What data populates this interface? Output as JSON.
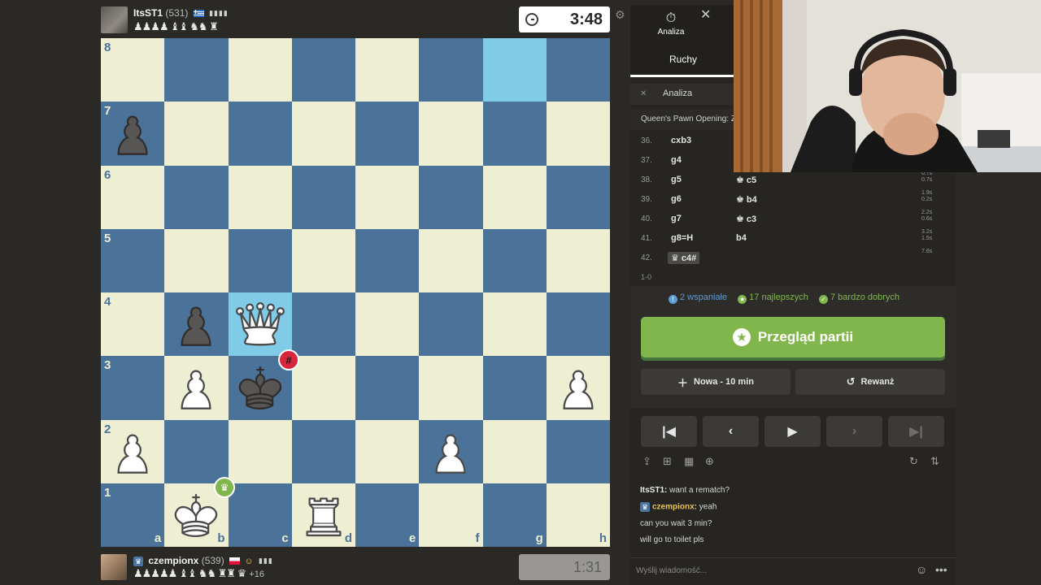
{
  "top_player": {
    "name": "ItsST1",
    "rating": "(531)",
    "captured": "♟♟♟♟ ♝♝ ♞♞ ♜",
    "clock": "3:48"
  },
  "bottom_player": {
    "name": "czempionx",
    "rating": "(539)",
    "captured": "♟♟♟♟♟ ♝♝ ♞♞ ♜♜ ♛",
    "advantage": "+16",
    "clock": "1:31"
  },
  "board": {
    "ranks": [
      "8",
      "7",
      "6",
      "5",
      "4",
      "3",
      "2",
      "1"
    ],
    "files": [
      "a",
      "b",
      "c",
      "d",
      "e",
      "f",
      "g",
      "h"
    ],
    "highlights": [
      "g8",
      "c4"
    ],
    "pieces": [
      {
        "square": "a7",
        "piece": "black-pawn"
      },
      {
        "square": "b4",
        "piece": "black-pawn"
      },
      {
        "square": "c4",
        "piece": "white-queen"
      },
      {
        "square": "b3",
        "piece": "white-pawn"
      },
      {
        "square": "c3",
        "piece": "black-king"
      },
      {
        "square": "h3",
        "piece": "white-pawn"
      },
      {
        "square": "a2",
        "piece": "white-pawn"
      },
      {
        "square": "f2",
        "piece": "white-pawn"
      },
      {
        "square": "b1",
        "piece": "white-king"
      },
      {
        "square": "d1",
        "piece": "white-rook"
      }
    ],
    "mate_badge": "#",
    "winner_badge": "♛"
  },
  "panel": {
    "analysis_tab": "Analiza",
    "moves_tab": "Ruchy",
    "analysis_toggle": "Analiza",
    "opening": "Queen's Pawn Opening: Z",
    "moves": [
      {
        "num": "36.",
        "white": "cxb3",
        "black": "",
        "times": [
          "",
          ""
        ]
      },
      {
        "num": "37.",
        "white": "g4",
        "black": "",
        "times": [
          "",
          ""
        ]
      },
      {
        "num": "38.",
        "white": "g5",
        "black": "♚ c5",
        "times": [
          "0.7s",
          "0.7s"
        ]
      },
      {
        "num": "39.",
        "white": "g6",
        "black": "♚ b4",
        "times": [
          "1.9s",
          "0.2s"
        ]
      },
      {
        "num": "40.",
        "white": "g7",
        "black": "♚ c3",
        "times": [
          "2.2s",
          "0.6s"
        ]
      },
      {
        "num": "41.",
        "white": "g8=H",
        "black": "b4",
        "times": [
          "3.2s",
          "1.5s"
        ]
      },
      {
        "num": "42.",
        "white": "♛ c4#",
        "black": "",
        "times": [
          "7.6s",
          ""
        ]
      }
    ],
    "result": "1-0",
    "stats": {
      "brilliant": "2 wspaniałe",
      "best": "17 najlepszych",
      "very_good": "7 bardzo dobrych"
    },
    "review_button": "Przegląd partii",
    "new_game_button": "Nowa - 10 min",
    "rematch_button": "Rewanż",
    "chat": [
      {
        "user": "ItsST1:",
        "text": " want a rematch?"
      },
      {
        "user": "czempionx:",
        "text": " yeah"
      },
      {
        "user": "",
        "text": "can you wait 3 min?"
      },
      {
        "user": "",
        "text": "will go to toilet pls"
      }
    ],
    "chat_placeholder": "Wyślij wiadomość..."
  }
}
